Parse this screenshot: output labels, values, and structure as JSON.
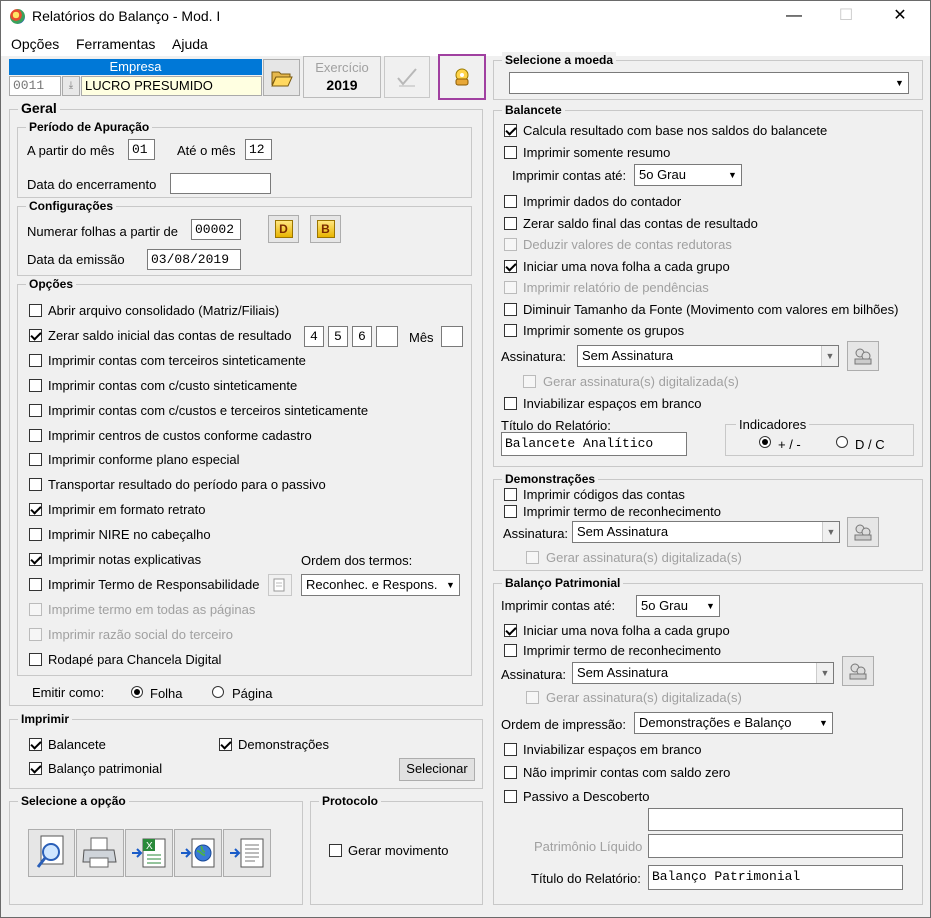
{
  "window": {
    "title": "Relatórios do Balanço - Mod. I",
    "controls": {
      "minimize": "—",
      "maximize": "☐",
      "close": "✕"
    }
  },
  "menu": [
    {
      "label": "Opções"
    },
    {
      "label": "Ferramentas"
    },
    {
      "label": "Ajuda"
    }
  ],
  "header": {
    "empresa_label": "Empresa",
    "empresa_code": "0011",
    "empresa_name": "LUCRO PRESUMIDO",
    "exercicio_label": "Exercício",
    "exercicio_value": "2019"
  },
  "geral": {
    "title": "Geral",
    "periodo": {
      "title": "Período de Apuração",
      "from_label": "A partir do mês",
      "from_value": "01",
      "to_label": "Até o mês",
      "to_value": "12",
      "encerramento_label": "Data do encerramento",
      "encerramento_value": ""
    },
    "config": {
      "title": "Configurações",
      "numerar_label": "Numerar folhas a partir de",
      "numerar_value": "00002",
      "btn_d": "D",
      "btn_b": "B",
      "emissao_label": "Data da emissão",
      "emissao_value": "03/08/2019"
    },
    "opcoes": {
      "title": "Opções",
      "items": [
        {
          "label": "Abrir arquivo consolidado (Matriz/Filiais)",
          "checked": false,
          "enabled": true
        },
        {
          "label": "Zerar saldo inicial das contas de resultado",
          "checked": true,
          "enabled": true
        },
        {
          "label": "Imprimir contas com terceiros sinteticamente",
          "checked": false,
          "enabled": true
        },
        {
          "label": "Imprimir contas com c/custo sinteticamente",
          "checked": false,
          "enabled": true
        },
        {
          "label": "Imprimir contas com c/custos e terceiros sinteticamente",
          "checked": false,
          "enabled": true
        },
        {
          "label": "Imprimir centros de custos conforme cadastro",
          "checked": false,
          "enabled": true
        },
        {
          "label": "Imprimir conforme plano especial",
          "checked": false,
          "enabled": true
        },
        {
          "label": "Transportar resultado do período para o passivo",
          "checked": false,
          "enabled": true
        },
        {
          "label": "Imprimir em formato retrato",
          "checked": true,
          "enabled": true
        },
        {
          "label": "Imprimir NIRE no cabeçalho",
          "checked": false,
          "enabled": true
        },
        {
          "label": "Imprimir notas explicativas",
          "checked": true,
          "enabled": true
        },
        {
          "label": "Imprimir Termo de Responsabilidade",
          "checked": false,
          "enabled": true
        },
        {
          "label": "Imprime termo em todas as páginas",
          "checked": false,
          "enabled": false
        },
        {
          "label": "Imprimir razão social do terceiro",
          "checked": false,
          "enabled": false
        },
        {
          "label": "Rodapé para Chancela Digital",
          "checked": false,
          "enabled": true
        }
      ],
      "zerar_digits": [
        "4",
        "5",
        "6",
        ""
      ],
      "mes_label": "Mês",
      "mes_value": "",
      "ordem_label": "Ordem dos termos:",
      "ordem_value": "Reconhec. e Respons."
    },
    "emitir": {
      "label": "Emitir como:",
      "options": [
        {
          "label": "Folha",
          "checked": true
        },
        {
          "label": "Página",
          "checked": false
        }
      ]
    }
  },
  "imprimir": {
    "title": "Imprimir",
    "balancete": {
      "label": "Balancete",
      "checked": true
    },
    "demonstracoes": {
      "label": "Demonstrações",
      "checked": true
    },
    "balanco": {
      "label": "Balanço patrimonial",
      "checked": true
    },
    "selecionar_label": "Selecionar"
  },
  "selecione_opcao": {
    "title": "Selecione a opção"
  },
  "protocolo": {
    "title": "Protocolo",
    "gerar_label": "Gerar movimento",
    "gerar_checked": false
  },
  "moeda": {
    "title": "Selecione a moeda",
    "value": ""
  },
  "balancete": {
    "title": "Balancete",
    "items": [
      {
        "label": "Calcula resultado com base nos saldos do balancete",
        "checked": true,
        "enabled": true
      },
      {
        "label": "Imprimir somente resumo",
        "checked": false,
        "enabled": true
      }
    ],
    "contas_ate_label": "Imprimir contas até:",
    "contas_ate_value": "5o Grau",
    "items2": [
      {
        "label": "Imprimir dados do contador",
        "checked": false,
        "enabled": true
      },
      {
        "label": "Zerar saldo final das contas de resultado",
        "checked": false,
        "enabled": true
      },
      {
        "label": "Deduzir valores de contas redutoras",
        "checked": false,
        "enabled": false
      },
      {
        "label": "Iniciar uma nova folha a cada grupo",
        "checked": true,
        "enabled": true
      },
      {
        "label": "Imprimir relatório de pendências",
        "checked": false,
        "enabled": false
      },
      {
        "label": "Diminuir Tamanho da Fonte (Movimento com valores em bilhões)",
        "checked": false,
        "enabled": true
      },
      {
        "label": "Imprimir somente os grupos",
        "checked": false,
        "enabled": true
      }
    ],
    "assinatura_label": "Assinatura:",
    "assinatura_value": "Sem Assinatura",
    "gerar_assinatura_label": "Gerar assinatura(s) digitalizada(s)",
    "inviabilizar_label": "Inviabilizar espaços em branco",
    "titulo_label": "Título do Relatório:",
    "titulo_value": "Balancete Analítico",
    "indicadores_title": "Indicadores",
    "indicadores": [
      {
        "label": "+ / -",
        "checked": true
      },
      {
        "label": "D / C",
        "checked": false
      }
    ]
  },
  "demonstracoes": {
    "title": "Demonstrações",
    "items": [
      {
        "label": "Imprimir códigos das contas",
        "checked": false
      },
      {
        "label": "Imprimir termo de reconhecimento",
        "checked": false
      }
    ],
    "assinatura_label": "Assinatura:",
    "assinatura_value": "Sem Assinatura",
    "gerar_assinatura_label": "Gerar assinatura(s) digitalizada(s)"
  },
  "balanco_patrimonial": {
    "title": "Balanço Patrimonial",
    "contas_ate_label": "Imprimir contas até:",
    "contas_ate_value": "5o Grau",
    "items": [
      {
        "label": "Iniciar uma nova folha a cada grupo",
        "checked": true
      },
      {
        "label": "Imprimir termo de reconhecimento",
        "checked": false
      }
    ],
    "assinatura_label": "Assinatura:",
    "assinatura_value": "Sem Assinatura",
    "gerar_assinatura_label": "Gerar assinatura(s) digitalizada(s)",
    "ordem_label": "Ordem de impressão:",
    "ordem_value": "Demonstrações e Balanço",
    "items2": [
      {
        "label": "Inviabilizar espaços em branco",
        "checked": false
      },
      {
        "label": "Não imprimir contas com saldo zero",
        "checked": false
      },
      {
        "label": "Passivo a Descoberto",
        "checked": false
      }
    ],
    "descoberto_value": "",
    "pl_label": "Patrimônio Líquido",
    "pl_value": "",
    "titulo_label": "Título do Relatório:",
    "titulo_value": "Balanço Patrimonial"
  }
}
